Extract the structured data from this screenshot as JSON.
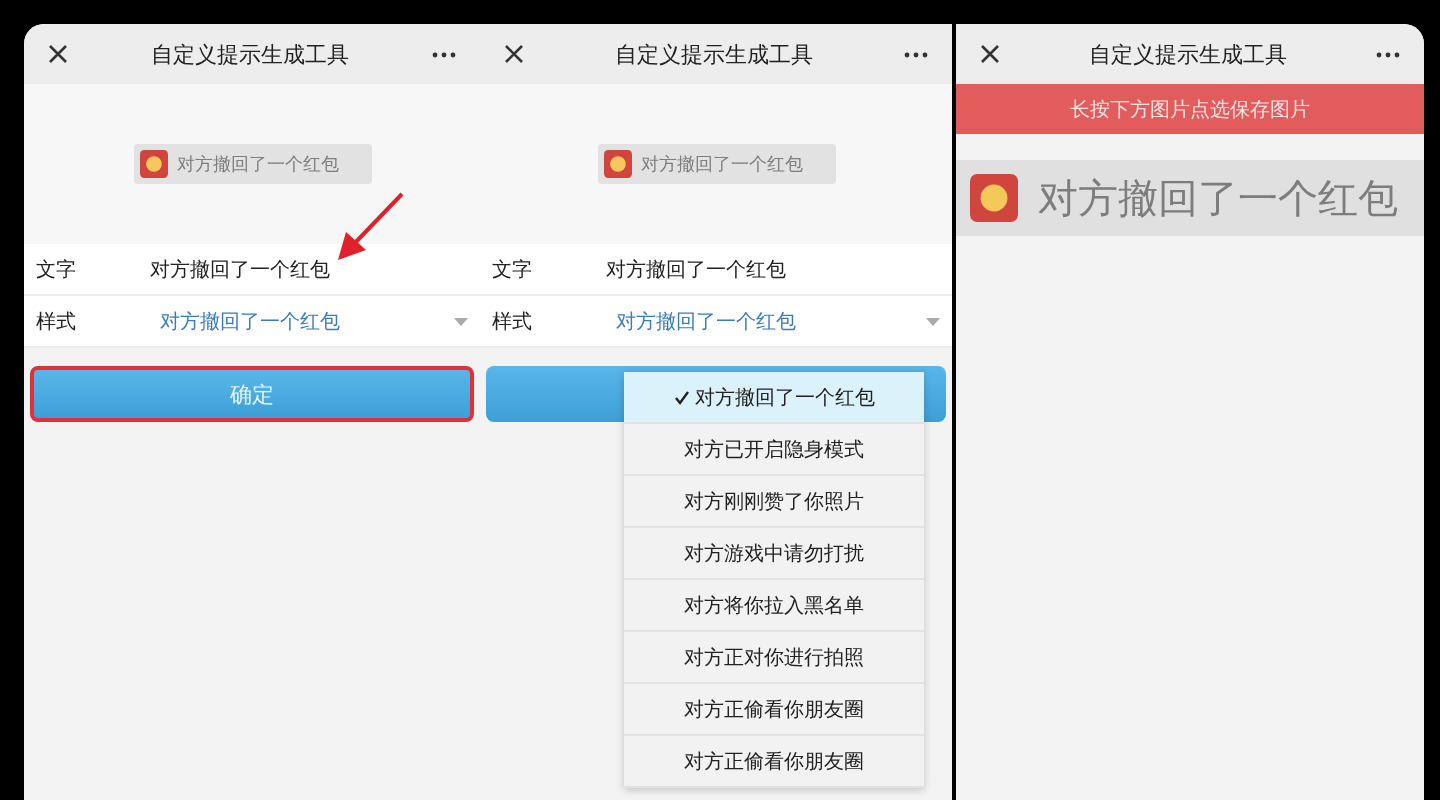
{
  "panels": [
    {
      "kind": "form",
      "title": "自定义提示生成工具",
      "preview": "对方撤回了一个红包",
      "fields": [
        {
          "label": "文字",
          "value": "对方撤回了一个红包",
          "kind": "text"
        },
        {
          "label": "样式",
          "value": "对方撤回了一个红包",
          "kind": "select"
        }
      ],
      "confirm_button": {
        "label": "确定",
        "highlighted": true
      },
      "arrow_annotation": true
    },
    {
      "kind": "form",
      "title": "自定义提示生成工具",
      "preview": "对方撤回了一个红包",
      "fields": [
        {
          "label": "文字",
          "value": "对方撤回了一个红包",
          "kind": "text"
        },
        {
          "label": "样式",
          "value": "对方撤回了一个红包",
          "kind": "select"
        }
      ],
      "confirm_button": {
        "highlighted": false
      },
      "dropdown": [
        {
          "label": "对方撤回了一个红包",
          "selected": true
        },
        {
          "label": "对方已开启隐身模式",
          "selected": false
        },
        {
          "label": "对方刚刚赞了你照片",
          "selected": false
        },
        {
          "label": "对方游戏中请勿打扰",
          "selected": false
        },
        {
          "label": "对方将你拉入黑名单",
          "selected": false
        },
        {
          "label": "对方正对你进行拍照",
          "selected": false
        },
        {
          "label": "对方正偷看你朋友圈",
          "selected": false
        },
        {
          "label": "对方正偷看你朋友圈",
          "selected": false
        }
      ]
    },
    {
      "kind": "result",
      "title": "自定义提示生成工具",
      "banner": "长按下方图片点选保存图片",
      "preview": "对方撤回了一个红包"
    }
  ]
}
